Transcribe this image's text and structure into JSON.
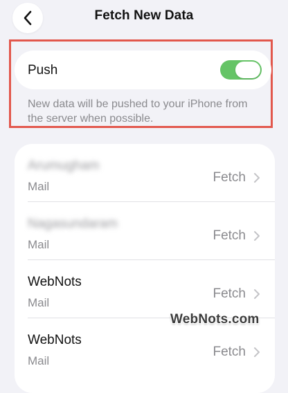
{
  "header": {
    "title": "Fetch New Data",
    "back_icon": "chevron-left-icon"
  },
  "push": {
    "label": "Push",
    "enabled": true,
    "toggle_color": "#65c466",
    "description": "New data will be pushed to your iPhone from the server when possible."
  },
  "highlight_color": "#e2574c",
  "accounts": [
    {
      "name": "Arumugham",
      "type": "Mail",
      "value": "Fetch",
      "blurred": true
    },
    {
      "name": "Nagasundaram",
      "type": "Mail",
      "value": "Fetch",
      "blurred": true
    },
    {
      "name": "WebNots",
      "type": "Mail",
      "value": "Fetch",
      "blurred": false
    },
    {
      "name": "WebNots",
      "type": "Mail",
      "value": "Fetch",
      "blurred": false
    }
  ],
  "watermark": "WebNots.com"
}
